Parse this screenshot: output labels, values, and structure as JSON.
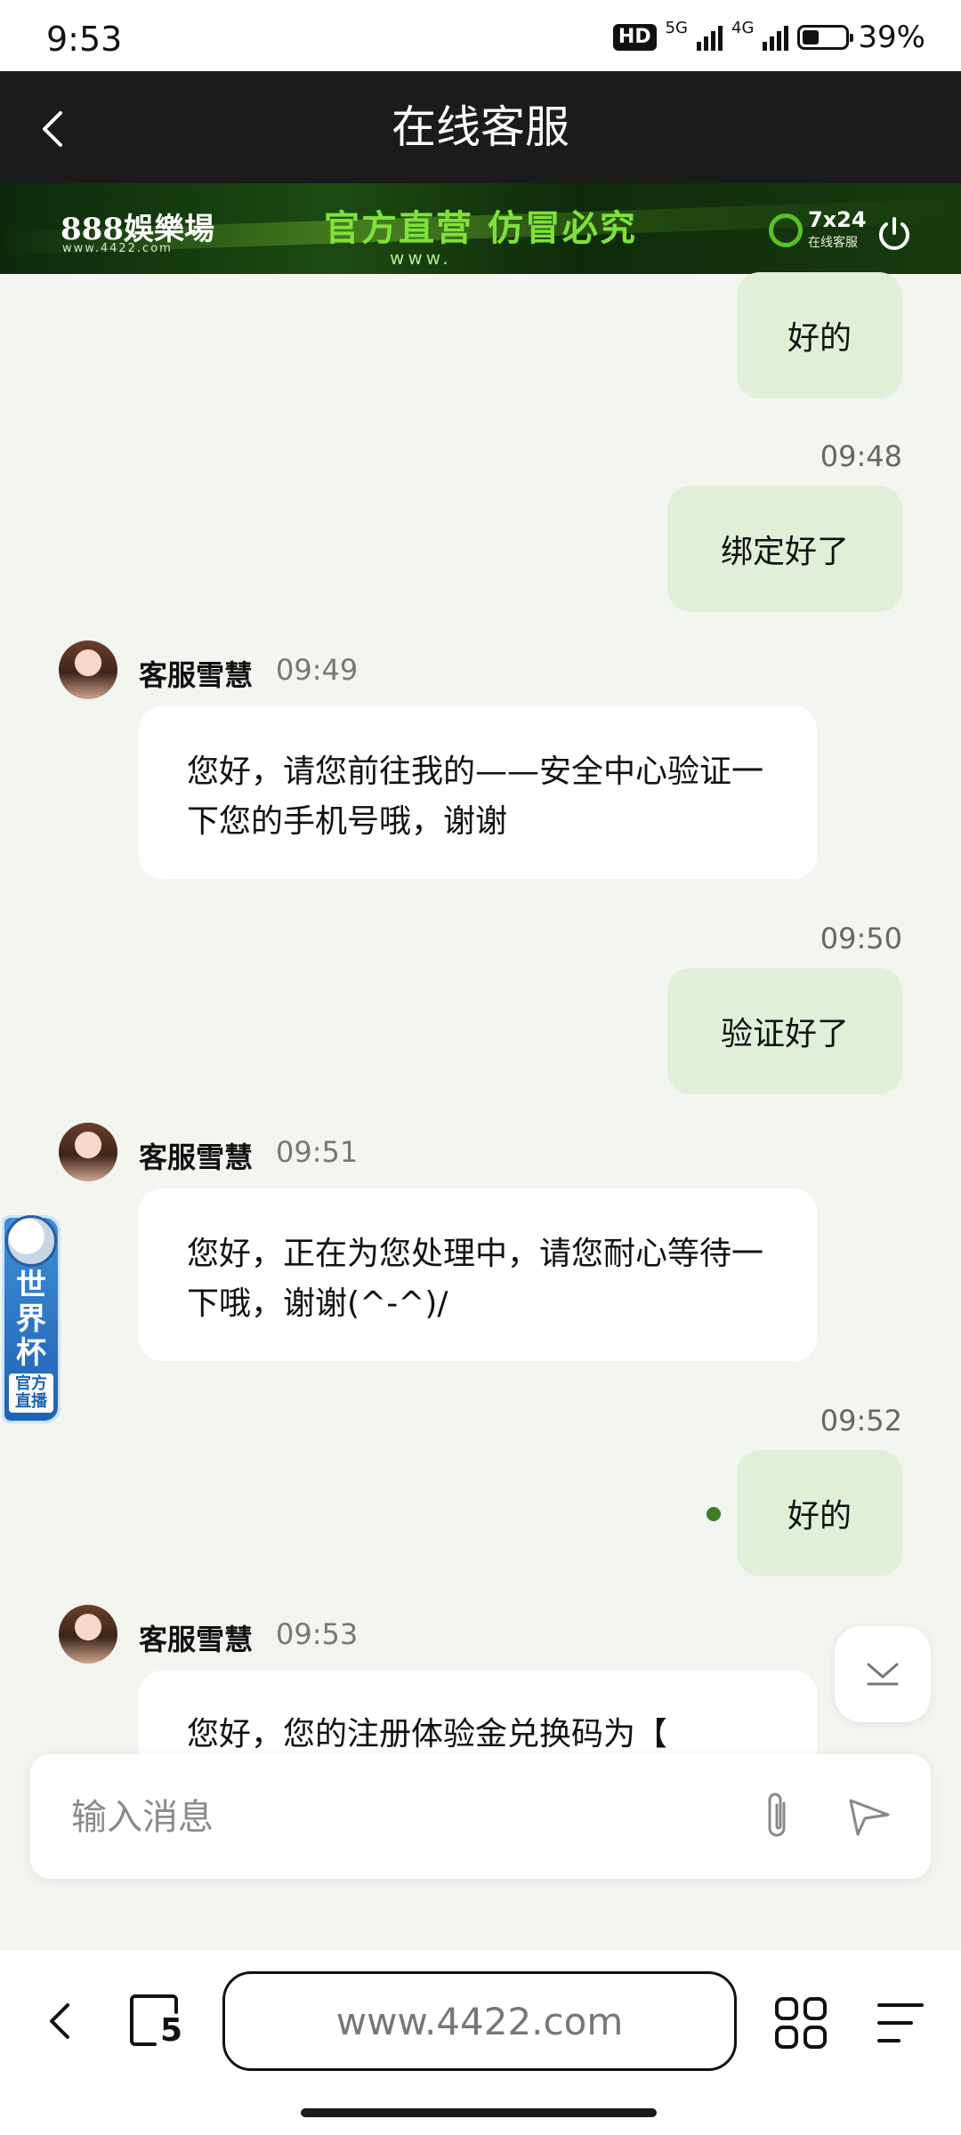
{
  "status_bar": {
    "time": "9:53",
    "hd_badge": "HD",
    "net_5g": "5G",
    "net_4g": "4G",
    "battery_percent": "39%"
  },
  "header": {
    "title": "在线客服"
  },
  "banner": {
    "logo": "888娛樂場",
    "logo_sub": "www.4422.com",
    "slogan": "官方直营  仿冒必究",
    "slogan_sub": "www.",
    "service_title": "7x24",
    "service_sub": "在线客服"
  },
  "chat": {
    "messages": [
      {
        "from": "me",
        "text": "好的"
      },
      {
        "from": "me",
        "time": "09:48",
        "text": "绑定好了"
      },
      {
        "from": "agent",
        "name": "客服雪慧",
        "time": "09:49",
        "text": "您好，请您前往我的——安全中心验证一下您的手机号哦，谢谢"
      },
      {
        "from": "me",
        "time": "09:50",
        "text": "验证好了"
      },
      {
        "from": "agent",
        "name": "客服雪慧",
        "time": "09:51",
        "text": "您好，正在为您处理中，请您耐心等待一下哦，谢谢(^-^)/"
      },
      {
        "from": "me",
        "time": "09:52",
        "text": "好的"
      },
      {
        "from": "agent",
        "name": "客服雪慧",
        "time": "09:53",
        "text": "您好，您的注册体验金兑换码为【"
      }
    ]
  },
  "composer": {
    "placeholder": "输入消息"
  },
  "worldcup_badge": {
    "title": "世界杯",
    "sub": "官方直播"
  },
  "browser": {
    "url": "www.4422.com",
    "tab_count": "5"
  }
}
